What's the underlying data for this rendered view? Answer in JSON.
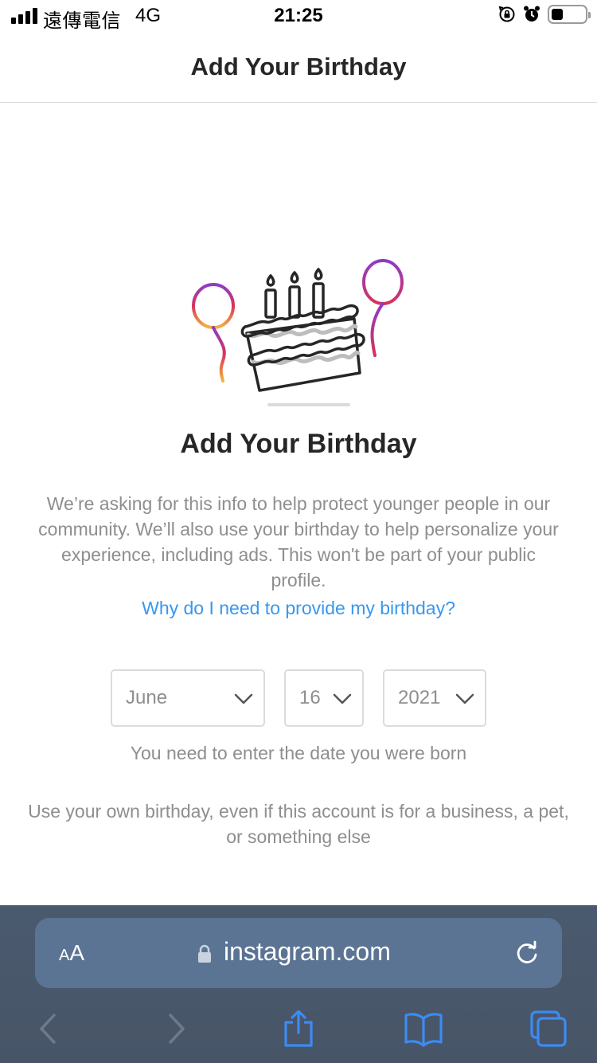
{
  "status_bar": {
    "carrier": "遠傳電信",
    "network": "4G",
    "time": "21:25",
    "icons": [
      "signal-icon",
      "orientation-lock-icon",
      "alarm-icon",
      "battery-icon"
    ],
    "battery_level": 0.25
  },
  "header": {
    "title": "Add Your Birthday"
  },
  "main": {
    "illustration": "birthday-cake-with-balloons-icon",
    "title": "Add Your Birthday",
    "description": "We’re asking for this info to help protect younger people in our community. We’ll also use your birthday to help personalize your experience, including ads. This won't be part of your public profile.",
    "why_link": "Why do I need to provide my birthday?"
  },
  "birthday_form": {
    "month": "June",
    "day": "16",
    "year": "2021",
    "hint": "You need to enter the date you were born",
    "note": "Use your own birthday, even if this account is for a business, a pet, or something else"
  },
  "browser": {
    "text_size_button": "AA",
    "url": "instagram.com",
    "icons": [
      "lock-icon",
      "reload-icon",
      "back-icon",
      "forward-icon",
      "share-icon",
      "bookmarks-icon",
      "tabs-icon"
    ]
  },
  "colors": {
    "link": "#3897f0",
    "muted_text": "#8e8e8e",
    "border": "#dbdbdb",
    "safari_bar": "#475567",
    "address_bar": "#5b7493"
  }
}
